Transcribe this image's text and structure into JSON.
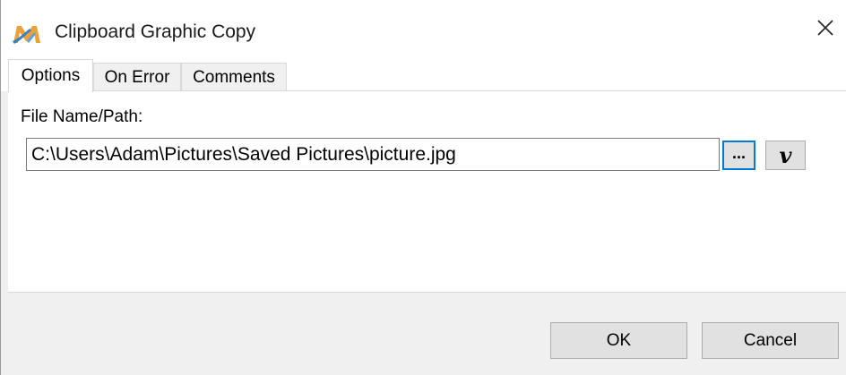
{
  "window": {
    "title": "Clipboard Graphic Copy",
    "icon": "app-logo-icon",
    "close_icon": "close-icon"
  },
  "tabs": [
    {
      "label": "Options",
      "active": true
    },
    {
      "label": "On Error",
      "active": false
    },
    {
      "label": "Comments",
      "active": false
    }
  ],
  "options": {
    "file_label": "File Name/Path:",
    "file_path": "C:\\Users\\Adam\\Pictures\\Saved Pictures\\picture.jpg",
    "browse_label": "...",
    "variable_label": "v"
  },
  "buttons": {
    "ok": "OK",
    "cancel": "Cancel"
  },
  "colors": {
    "focus_border": "#0078d7",
    "button_face": "#e1e1e1",
    "dialog_background": "#f0f0f0"
  }
}
